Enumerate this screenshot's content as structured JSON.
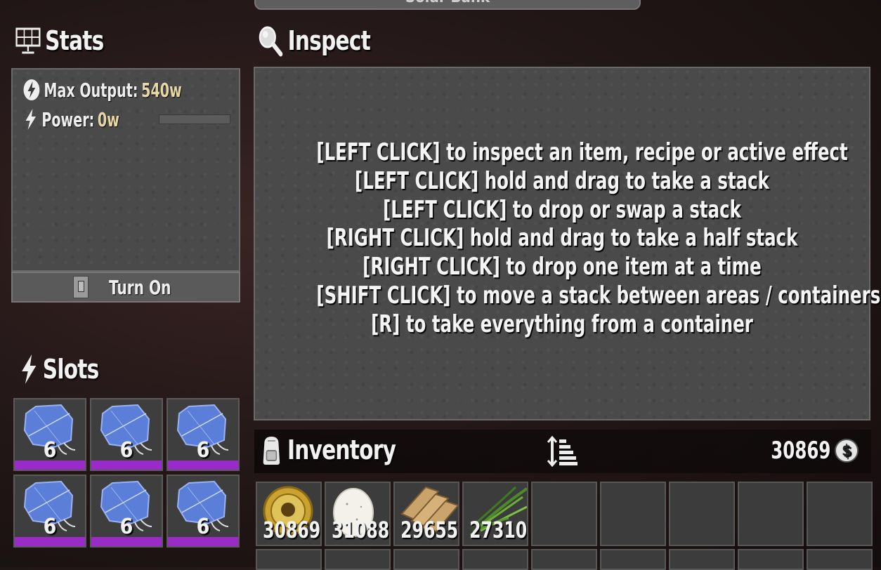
{
  "window": {
    "title": "Solar Bank"
  },
  "stats": {
    "header": "Stats",
    "max_output_label": "Max Output:",
    "max_output_value": "540w",
    "power_label": "Power:",
    "power_value": "0w",
    "power_fraction": 0.0,
    "toggle_label": "Turn On"
  },
  "slots": {
    "header": "Slots",
    "items": [
      {
        "icon": "solar-cell-icon",
        "count": "6"
      },
      {
        "icon": "solar-cell-icon",
        "count": "6"
      },
      {
        "icon": "solar-cell-icon",
        "count": "6"
      },
      {
        "icon": "solar-cell-icon",
        "count": "6"
      },
      {
        "icon": "solar-cell-icon",
        "count": "6"
      },
      {
        "icon": "solar-cell-icon",
        "count": "6"
      }
    ],
    "durability_color": "#9a2bc9"
  },
  "inspect": {
    "header": "Inspect",
    "lines": [
      "[LEFT CLICK] to inspect an item, recipe or active effect",
      "[LEFT CLICK] hold and drag to take a stack",
      "[LEFT CLICK] to drop or swap a stack",
      "[RIGHT CLICK] hold and drag to take a half stack",
      "[RIGHT CLICK] to drop one item at a time",
      "[SHIFT CLICK] to move a stack between areas / containers",
      "[R] to take everything from a container"
    ]
  },
  "inventory": {
    "header": "Inventory",
    "currency": "30869",
    "currency_icon": "coin-icon",
    "slots": [
      {
        "icon": "dukes-casino-token-icon",
        "count": "30869"
      },
      {
        "icon": "egg-icon",
        "count": "31088"
      },
      {
        "icon": "wood-icon",
        "count": "29655"
      },
      {
        "icon": "plant-fiber-icon",
        "count": "27310"
      },
      {
        "icon": "",
        "count": ""
      },
      {
        "icon": "",
        "count": ""
      },
      {
        "icon": "",
        "count": ""
      },
      {
        "icon": "",
        "count": ""
      },
      {
        "icon": "",
        "count": ""
      }
    ]
  }
}
